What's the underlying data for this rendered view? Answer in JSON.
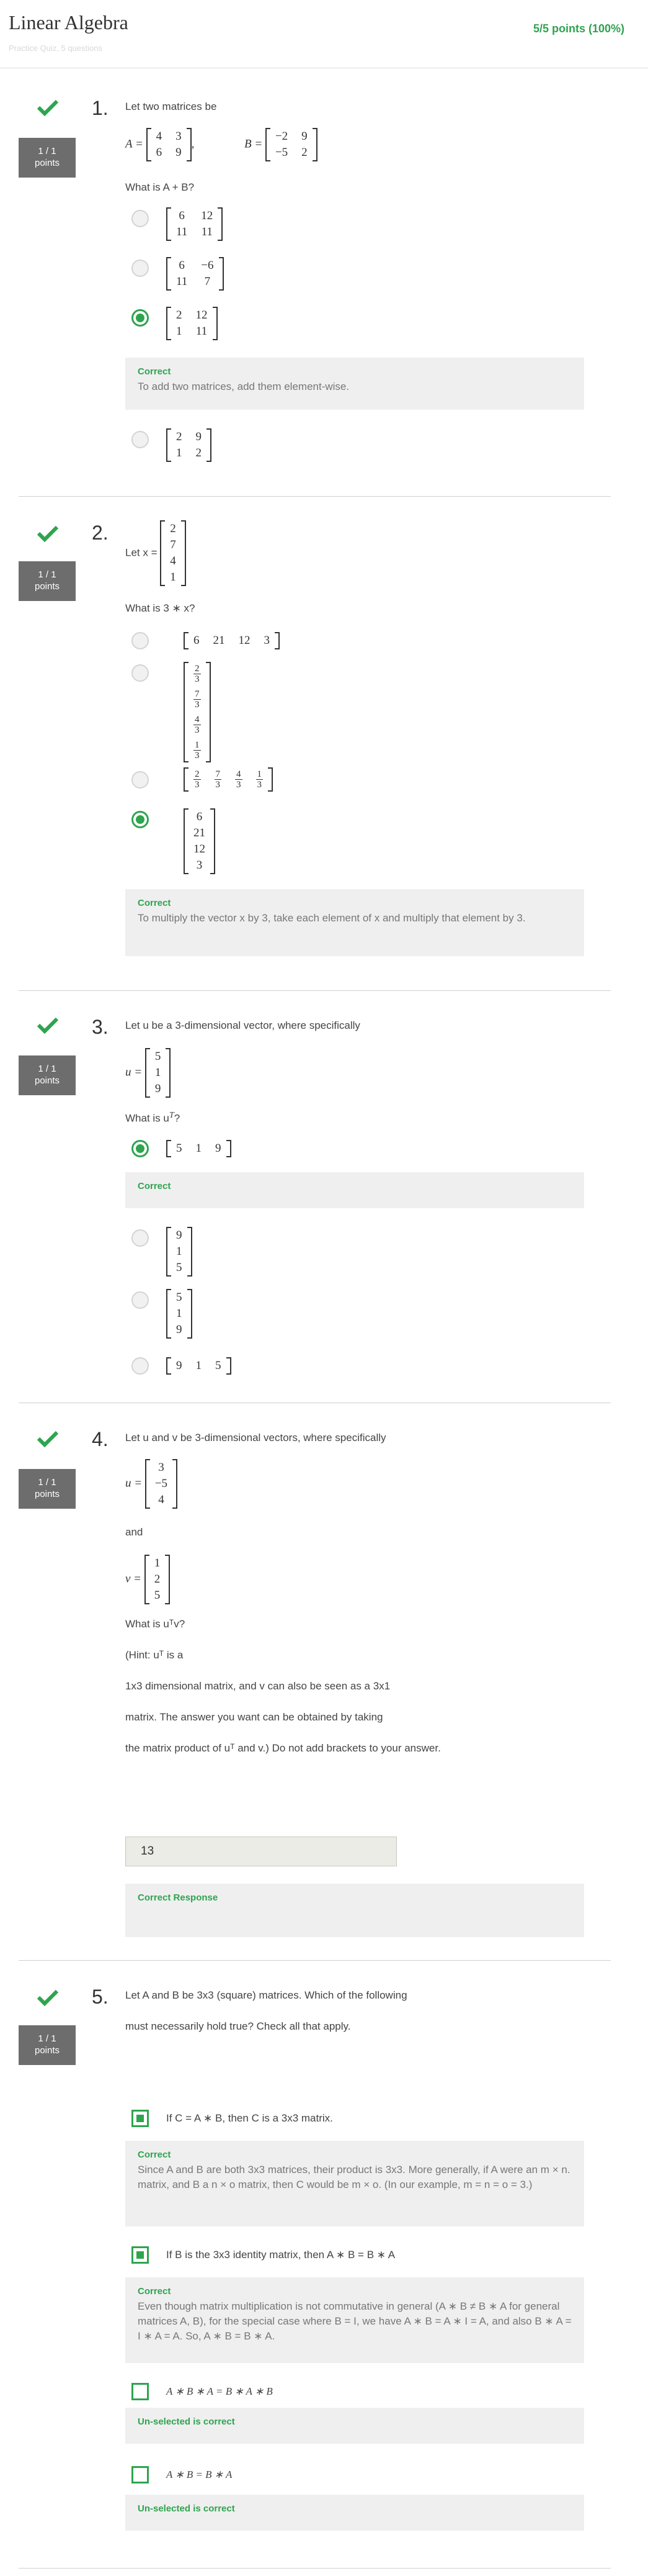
{
  "header": {
    "title": "Linear Algebra",
    "subtitle": "Practice Quiz, 5 questions",
    "score": "5/5 points (100%)"
  },
  "points_label": "1 / 1\npoints",
  "q1": {
    "number": "1.",
    "intro": "Let two matrices be",
    "A_label": "A =",
    "A": [
      [
        "4",
        "3"
      ],
      [
        "6",
        "9"
      ]
    ],
    "B_label": "B =",
    "B": [
      [
        "−2",
        "9"
      ],
      [
        "−5",
        "2"
      ]
    ],
    "question": "What is A + B?",
    "options": [
      [
        [
          "6",
          "12"
        ],
        [
          "11",
          "11"
        ]
      ],
      [
        [
          "6",
          "−6"
        ],
        [
          "11",
          "7"
        ]
      ],
      [
        [
          "2",
          "12"
        ],
        [
          "1",
          "11"
        ]
      ],
      [
        [
          "2",
          "9"
        ],
        [
          "1",
          "2"
        ]
      ]
    ],
    "feedback_title": "Correct",
    "feedback_text": "To add two matrices, add them element-wise."
  },
  "q2": {
    "number": "2.",
    "intro": "Let x =",
    "x": [
      "2",
      "7",
      "4",
      "1"
    ],
    "question": "What is 3 ∗ x?",
    "option1": [
      "6",
      "21",
      "12",
      "3"
    ],
    "option2_fracs": [
      [
        "2",
        "3"
      ],
      [
        "7",
        "3"
      ],
      [
        "4",
        "3"
      ],
      [
        "1",
        "3"
      ]
    ],
    "option4": [
      "6",
      "21",
      "12",
      "3"
    ],
    "feedback_title": "Correct",
    "feedback_text": "To multiply the vector x by 3, take each element of x and multiply that element by 3."
  },
  "q3": {
    "number": "3.",
    "intro": "Let u be a 3-dimensional vector, where specifically",
    "u_label": "u =",
    "u": [
      "5",
      "1",
      "9"
    ],
    "question": "What is u",
    "question_sup": "T",
    "question_end": "?",
    "option1": [
      "5",
      "1",
      "9"
    ],
    "option2": [
      "9",
      "1",
      "5"
    ],
    "option3": [
      "5",
      "1",
      "9"
    ],
    "option4": [
      "9",
      "1",
      "5"
    ],
    "feedback_title": "Correct"
  },
  "q4": {
    "number": "4.",
    "intro": "Let u and v be 3-dimensional vectors, where specifically",
    "u_label": "u =",
    "u": [
      "3",
      "−5",
      "4"
    ],
    "and": "and",
    "v_label": "v =",
    "v": [
      "1",
      "2",
      "5"
    ],
    "question": "What is uᵀv?",
    "hint1": "(Hint: uᵀ is a",
    "hint2": "1x3 dimensional matrix, and v can also be seen as a 3x1",
    "hint3": "matrix. The answer you want can be obtained by taking",
    "hint4": "the matrix product of uᵀ and v.) Do not add brackets to your answer.",
    "answer": "13",
    "feedback_title": "Correct Response"
  },
  "q5": {
    "number": "5.",
    "text1": "Let A and B be 3x3 (square) matrices. Which of the following",
    "text2": "must necessarily hold true? Check all that apply.",
    "opt1": "If C = A ∗ B, then C is a 3x3 matrix.",
    "fb1_title": "Correct",
    "fb1_text": "Since A and B are both 3x3 matrices, their product is 3x3. More generally, if A were an m × n. matrix, and B a n × o matrix, then C would be m × o. (In our example, m = n = o = 3.)",
    "opt2": "If B is the 3x3 identity matrix, then A ∗ B = B ∗ A",
    "fb2_title": "Correct",
    "fb2_text": "Even though matrix multiplication is not commutative in general (A ∗ B ≠ B ∗ A for general matrices A, B), for the special case where B = I, we have A ∗ B = A ∗ I = A, and also B ∗ A = I ∗ A = A. So, A ∗ B = B ∗ A.",
    "opt3": "A ∗ B ∗ A = B ∗ A ∗ B",
    "fb3_title": "Un-selected is correct",
    "opt4": "A ∗ B = B ∗ A",
    "fb4_title": "Un-selected is correct"
  },
  "colors": {
    "accent": "#2ea44f",
    "points_bg": "#6d6d6d",
    "feedback_bg": "#efefef"
  },
  "icons": {
    "check": "check-icon",
    "radio": "radio-button",
    "checkbox": "checkbox"
  }
}
